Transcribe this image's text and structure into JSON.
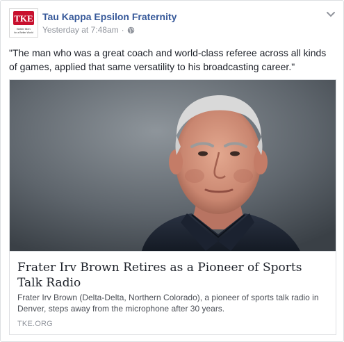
{
  "post": {
    "page_name": "Tau Kappa Epsilon Fraternity",
    "timestamp": "Yesterday at 7:48am",
    "separator": "·",
    "audience_icon": "globe-icon",
    "options_icon": "chevron-down-icon",
    "text": "\"The man who was a great coach and world-class referee across all kinds of games, applied that same versatility to his broadcasting career.\""
  },
  "logo": {
    "letters": "TKE",
    "motto_line1": "Better Men",
    "motto_line2": "for a Better World",
    "brand_color": "#c8102e"
  },
  "link_card": {
    "image_alt": "Portrait photo of Irv Brown",
    "title": "Frater Irv Brown Retires as a Pioneer of Sports Talk Radio",
    "description": "Frater Irv Brown (Delta-Delta, Northern Colorado), a pioneer of sports talk radio in Denver, steps away from the microphone after 30 years.",
    "domain": "TKE.ORG"
  },
  "colors": {
    "link_blue": "#365899",
    "meta_gray": "#90949c",
    "border": "#dddfe2",
    "text": "#1d2129"
  }
}
